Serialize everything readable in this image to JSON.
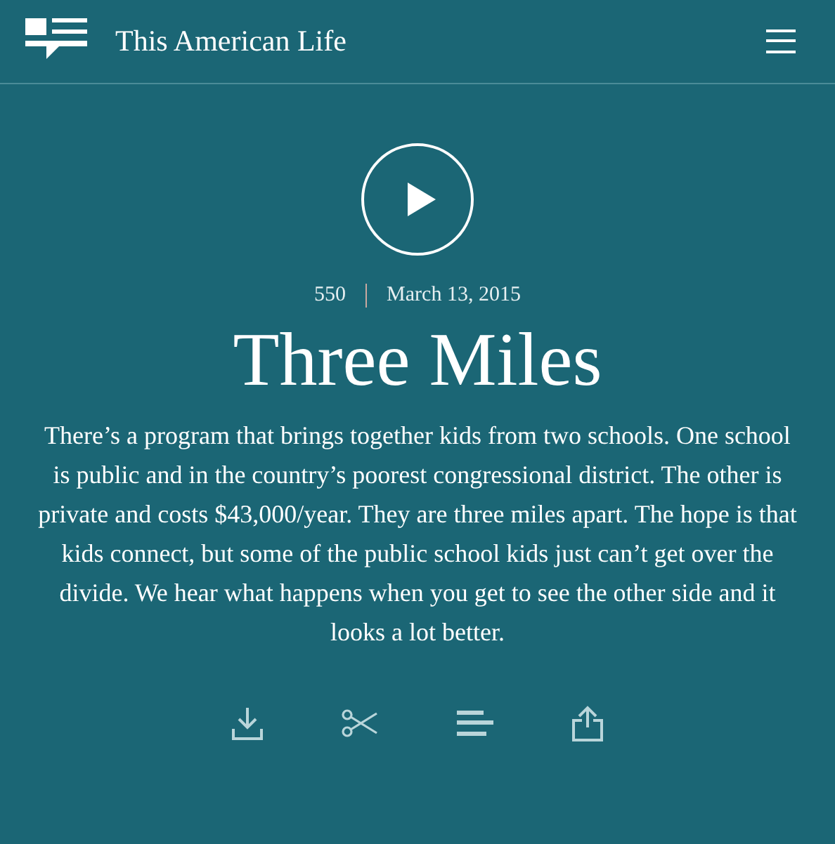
{
  "header": {
    "title": "This American Life"
  },
  "episode": {
    "number": "550",
    "date": "March 13, 2015",
    "title": "Three Miles",
    "description": "There’s a program that brings together kids from two schools. One school is public and in the country’s poorest congressional district. The other is private and costs $43,000/year. They are three miles apart. The hope is that kids connect, but some of the public school kids just can’t get over the divide. We hear what happens when you get to see the other side and it looks a lot better."
  },
  "actions": [
    {
      "kind": "download"
    },
    {
      "kind": "clip"
    },
    {
      "kind": "transcript"
    },
    {
      "kind": "share"
    }
  ]
}
